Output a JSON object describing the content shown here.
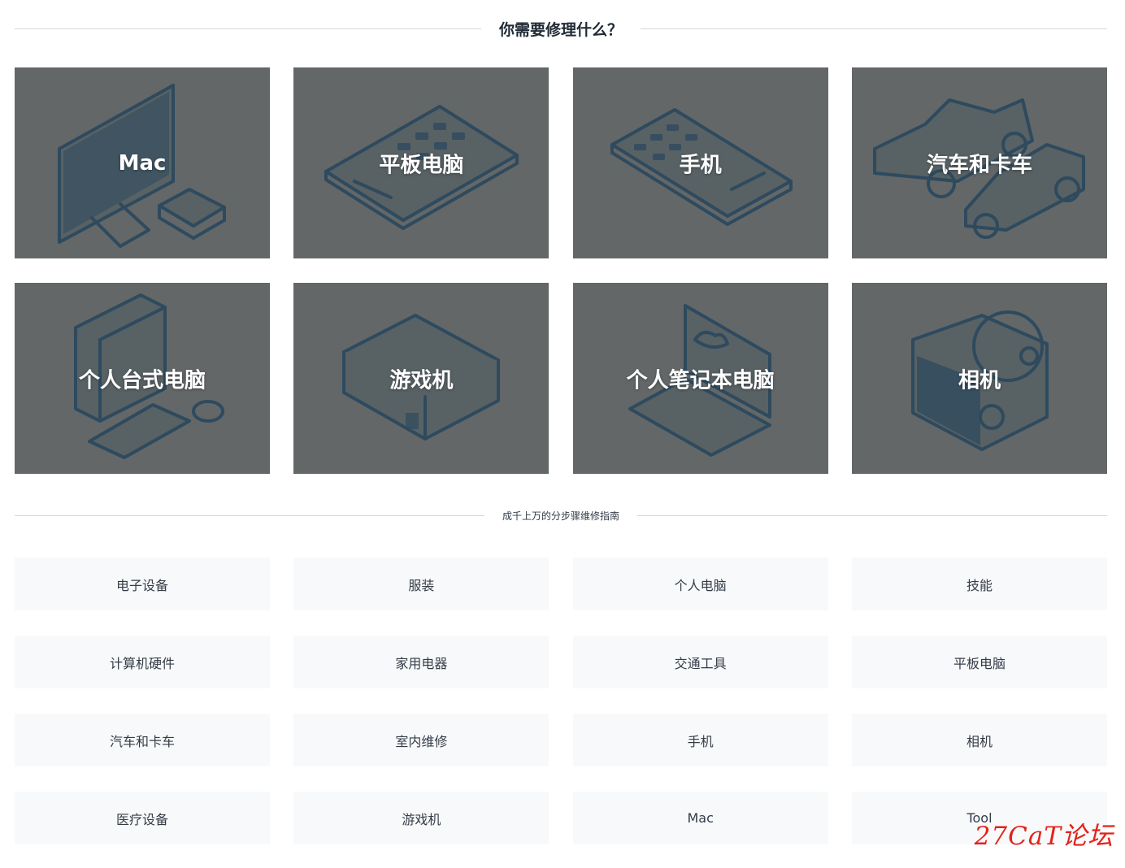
{
  "header": {
    "title": "你需要修理什么？"
  },
  "categories": [
    {
      "label": "Mac",
      "icon": "imac-icon"
    },
    {
      "label": "平板电脑",
      "icon": "tablet-icon"
    },
    {
      "label": "手机",
      "icon": "phone-icon"
    },
    {
      "label": "汽车和卡车",
      "icon": "car-truck-icon"
    },
    {
      "label": "个人台式电脑",
      "icon": "desktop-pc-icon"
    },
    {
      "label": "游戏机",
      "icon": "game-console-icon"
    },
    {
      "label": "个人笔记本电脑",
      "icon": "laptop-icon"
    },
    {
      "label": "相机",
      "icon": "camera-icon"
    }
  ],
  "guides": {
    "title": "成千上万的分步骤维修指南",
    "items": [
      "电子设备",
      "服装",
      "个人电脑",
      "技能",
      "计算机硬件",
      "家用电器",
      "交通工具",
      "平板电脑",
      "汽车和卡车",
      "室内维修",
      "手机",
      "相机",
      "医疗设备",
      "游戏机",
      "Mac",
      "Tool"
    ]
  },
  "watermark": "27CaT论坛",
  "colors": {
    "card_bg": "#636768",
    "illustration": "#2e4a5e",
    "guide_bg": "#f8f9fa",
    "watermark": "#e2231a"
  }
}
